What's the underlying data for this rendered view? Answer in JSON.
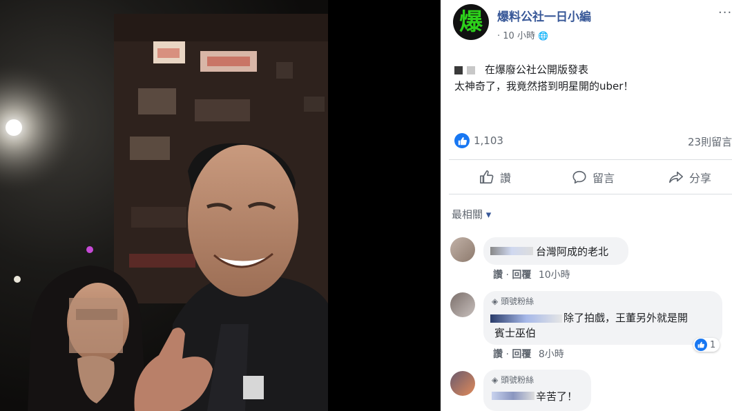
{
  "page": {
    "name": "爆料公社一日小編",
    "avatar_glyph": "爆",
    "time": "10 小時",
    "privacy_glyph": "🌐",
    "more_glyph": "···"
  },
  "post": {
    "line1": "在爆廢公社公開版發表",
    "line2": "太神奇了，我竟然搭到明星開的uber！"
  },
  "stats": {
    "likes": "1,103",
    "comments": "23則留言"
  },
  "actions": {
    "like": "讚",
    "comment": "留言",
    "share": "分享"
  },
  "sort": {
    "label": "最相關",
    "caret": "▾"
  },
  "comments": [
    {
      "text": "台灣阿成的老北",
      "reply": "回覆",
      "like": "讚",
      "time": "10小時",
      "sep": "·"
    },
    {
      "badge": "頭號粉絲",
      "text_a": "除了拍戲，王董另外就是開",
      "text_b": "賓士巫伯",
      "reply": "回覆",
      "like": "讚",
      "time": "8小時",
      "sep": "·",
      "reactions": "1"
    },
    {
      "badge": "頭號粉絲",
      "text": "辛苦了！"
    }
  ],
  "colors": {
    "link": "#385898",
    "accent": "#1877f2",
    "logo_green": "#2dd11b"
  }
}
